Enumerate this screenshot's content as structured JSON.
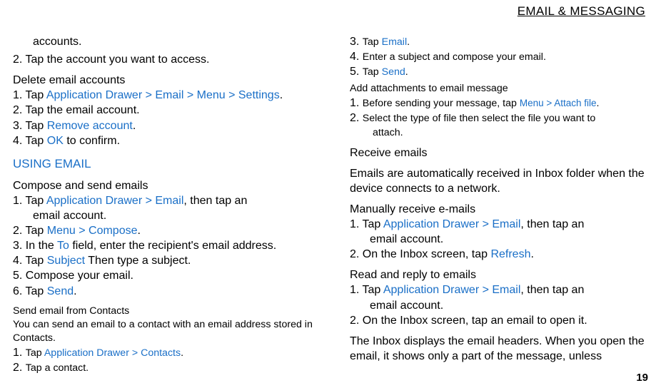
{
  "header": {
    "title": "EMAIL & MESSAGING"
  },
  "pageNumber": "19",
  "left": {
    "frag1": "accounts.",
    "step2": "2. Tap the account you want to access.",
    "del_hd": "Delete email accounts",
    "del_1a": "1. Tap ",
    "del_1b": "Application Drawer > Email > Menu > Settings",
    "del_1c": ".",
    "del_2": "2. Tap the email account.",
    "del_3a": "3. Tap ",
    "del_3b": "Remove account",
    "del_3c": ".",
    "del_4a": "4. Tap ",
    "del_4b": "OK",
    "del_4c": " to confirm.",
    "using_hd": "USING EMAIL",
    "comp_hd": "Compose and send emails",
    "comp_1a": "1. Tap ",
    "comp_1b": "Application Drawer > Email",
    "comp_1c": ", then tap an",
    "comp_1d": "email account.",
    "comp_2a": "2. Tap ",
    "comp_2b": "Menu > Compose",
    "comp_2c": ".",
    "comp_3a": "3. In the ",
    "comp_3b": "To",
    "comp_3c": " field, enter the recipient's email address.",
    "comp_4a": "4. Tap ",
    "comp_4b": "Subject",
    "comp_4c": " Then type a subject.",
    "comp_5": "5. Compose your email.",
    "comp_6a": "6. Tap ",
    "comp_6b": "Send",
    "comp_6c": ".",
    "sc_hd": "Send email from Contacts",
    "sc_p": "You can send an email to a contact with an email address stored in Contacts.",
    "sc_1a": "1. ",
    "sc_1b": "Tap ",
    "sc_1c": "Application Drawer > Contacts",
    "sc_1d": ".",
    "sc_2a": "2. ",
    "sc_2b": "Tap a contact."
  },
  "right": {
    "r3a": "3. ",
    "r3b": "Tap ",
    "r3c": "Email",
    "r3d": ".",
    "r4a": "4. ",
    "r4b": "Enter a subject and compose your email.",
    "r5a": "5. ",
    "r5b": "Tap ",
    "r5c": "Send",
    "r5d": ".",
    "att_hd": "Add attachments to email message",
    "att_1a": "1. ",
    "att_1b": "Before sending your message, tap ",
    "att_1c": "Menu > Attach file",
    "att_1d": ".",
    "att_2a": "2. ",
    "att_2b": "Select the type of file then select the file you want to",
    "att_2c": "attach.",
    "recv_hd": "Receive emails",
    "recv_p1": "Emails are automatically received in Inbox folder when the device connects to a network.",
    "man_hd": "Manually receive e-mails",
    "man_1a": "1. Tap ",
    "man_1b": "Application Drawer > Email",
    "man_1c": ", then tap an",
    "man_1d": "email account.",
    "man_2a": "2. On the Inbox screen, tap ",
    "man_2b": "Refresh",
    "man_2c": ".",
    "read_hd": "Read and reply to emails",
    "read_1a": "1. Tap ",
    "read_1b": "Application Drawer > Email",
    "read_1c": ", then tap an",
    "read_1d": "email account.",
    "read_2": "2. On the Inbox screen, tap an email to open it.",
    "tail": "The Inbox displays the email headers. When you open the email, it shows only a part of the message, unless"
  }
}
